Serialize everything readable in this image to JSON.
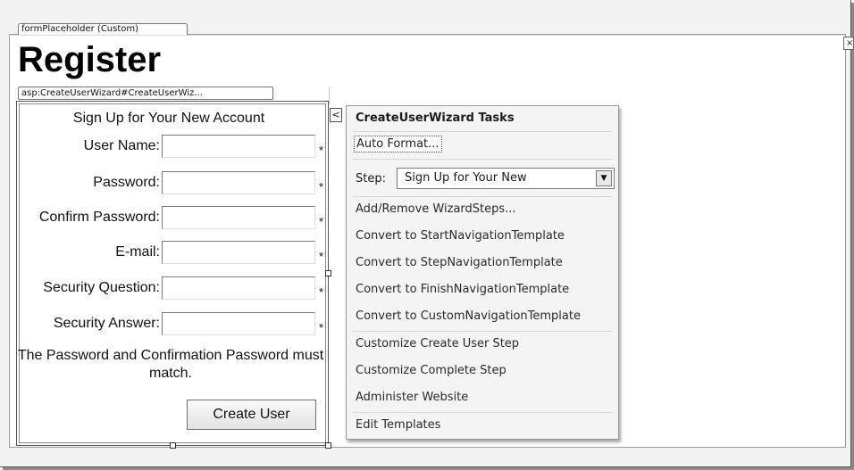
{
  "form_placeholder_tag": "formPlaceholder (Custom)",
  "page_heading": "Register",
  "wizard_tag": "asp:CreateUserWizard#CreateUserWiz...",
  "side_close_glyph": "×",
  "wizard": {
    "title": "Sign Up for Your New Account",
    "fields": [
      {
        "label": "User Name:",
        "value": "",
        "required_mark": "*"
      },
      {
        "label": "Password:",
        "value": "",
        "required_mark": "*"
      },
      {
        "label": "Confirm Password:",
        "value": "",
        "required_mark": "*"
      },
      {
        "label": "E-mail:",
        "value": "",
        "required_mark": "*"
      },
      {
        "label": "Security Question:",
        "value": "",
        "required_mark": "*"
      },
      {
        "label": "Security Answer:",
        "value": "",
        "required_mark": "*"
      }
    ],
    "match_message": "The Password and Confirmation Password must match.",
    "create_button": "Create User"
  },
  "smart_tag_glyph": "<",
  "tasks": {
    "header": "CreateUserWizard Tasks",
    "auto_format": "Auto Format...",
    "step_label": "Step:",
    "step_value": "Sign Up for Your New",
    "step_arrow": "▼",
    "items": [
      "Add/Remove WizardSteps...",
      "Convert to StartNavigationTemplate",
      "Convert to StepNavigationTemplate",
      "Convert to FinishNavigationTemplate",
      "Convert to CustomNavigationTemplate",
      "Customize Create User Step",
      "Customize Complete Step",
      "Administer Website",
      "Edit Templates"
    ]
  }
}
